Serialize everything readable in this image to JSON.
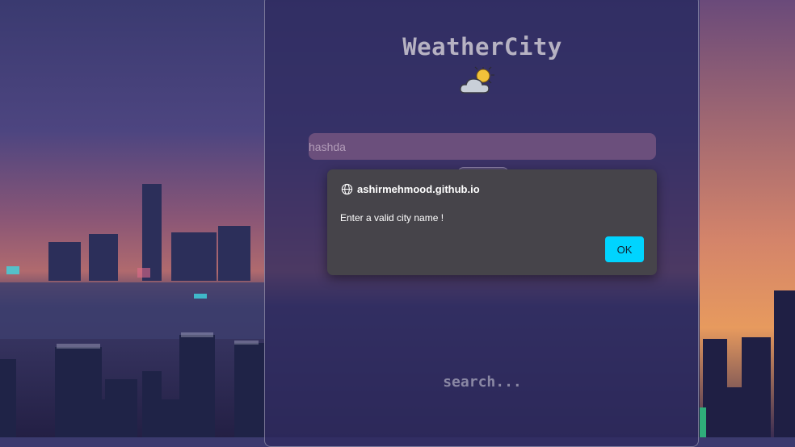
{
  "app": {
    "title": "WeatherCity",
    "weather_icon": "partly-cloudy-icon",
    "search_value": "hashda",
    "status_text": "search..."
  },
  "dialog": {
    "origin": "ashirmehmood.github.io",
    "origin_icon": "globe-icon",
    "message": "Enter a valid city name !",
    "ok_label": "OK"
  },
  "colors": {
    "dialog_background": "#46444a",
    "ok_button": "#00d4ff",
    "input_background": "#6b4f7c"
  }
}
